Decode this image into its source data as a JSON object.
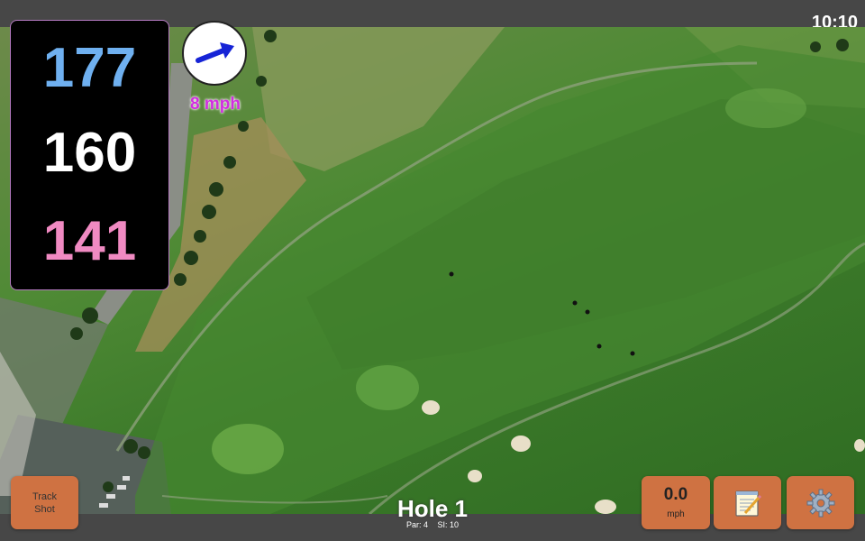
{
  "status": {
    "clock": "10:10"
  },
  "distances": {
    "back": "177",
    "middle": "160",
    "front": "141"
  },
  "wind": {
    "speed": "8 mph",
    "icon": "wind-direction-arrow"
  },
  "hole": {
    "title": "Hole 1",
    "par": "Par: 4",
    "si": "SI: 10"
  },
  "buttons": {
    "track_shot": "Track\nShot",
    "speed_value": "0.0",
    "speed_unit": "mph",
    "notes_icon": "notepad-icon",
    "settings_icon": "gear-icon"
  },
  "colors": {
    "button": "#cf7242",
    "back_distance": "#6fb0f0",
    "middle_distance": "#ffffff",
    "front_distance": "#f08ac2",
    "wind_text": "#d12de0"
  }
}
